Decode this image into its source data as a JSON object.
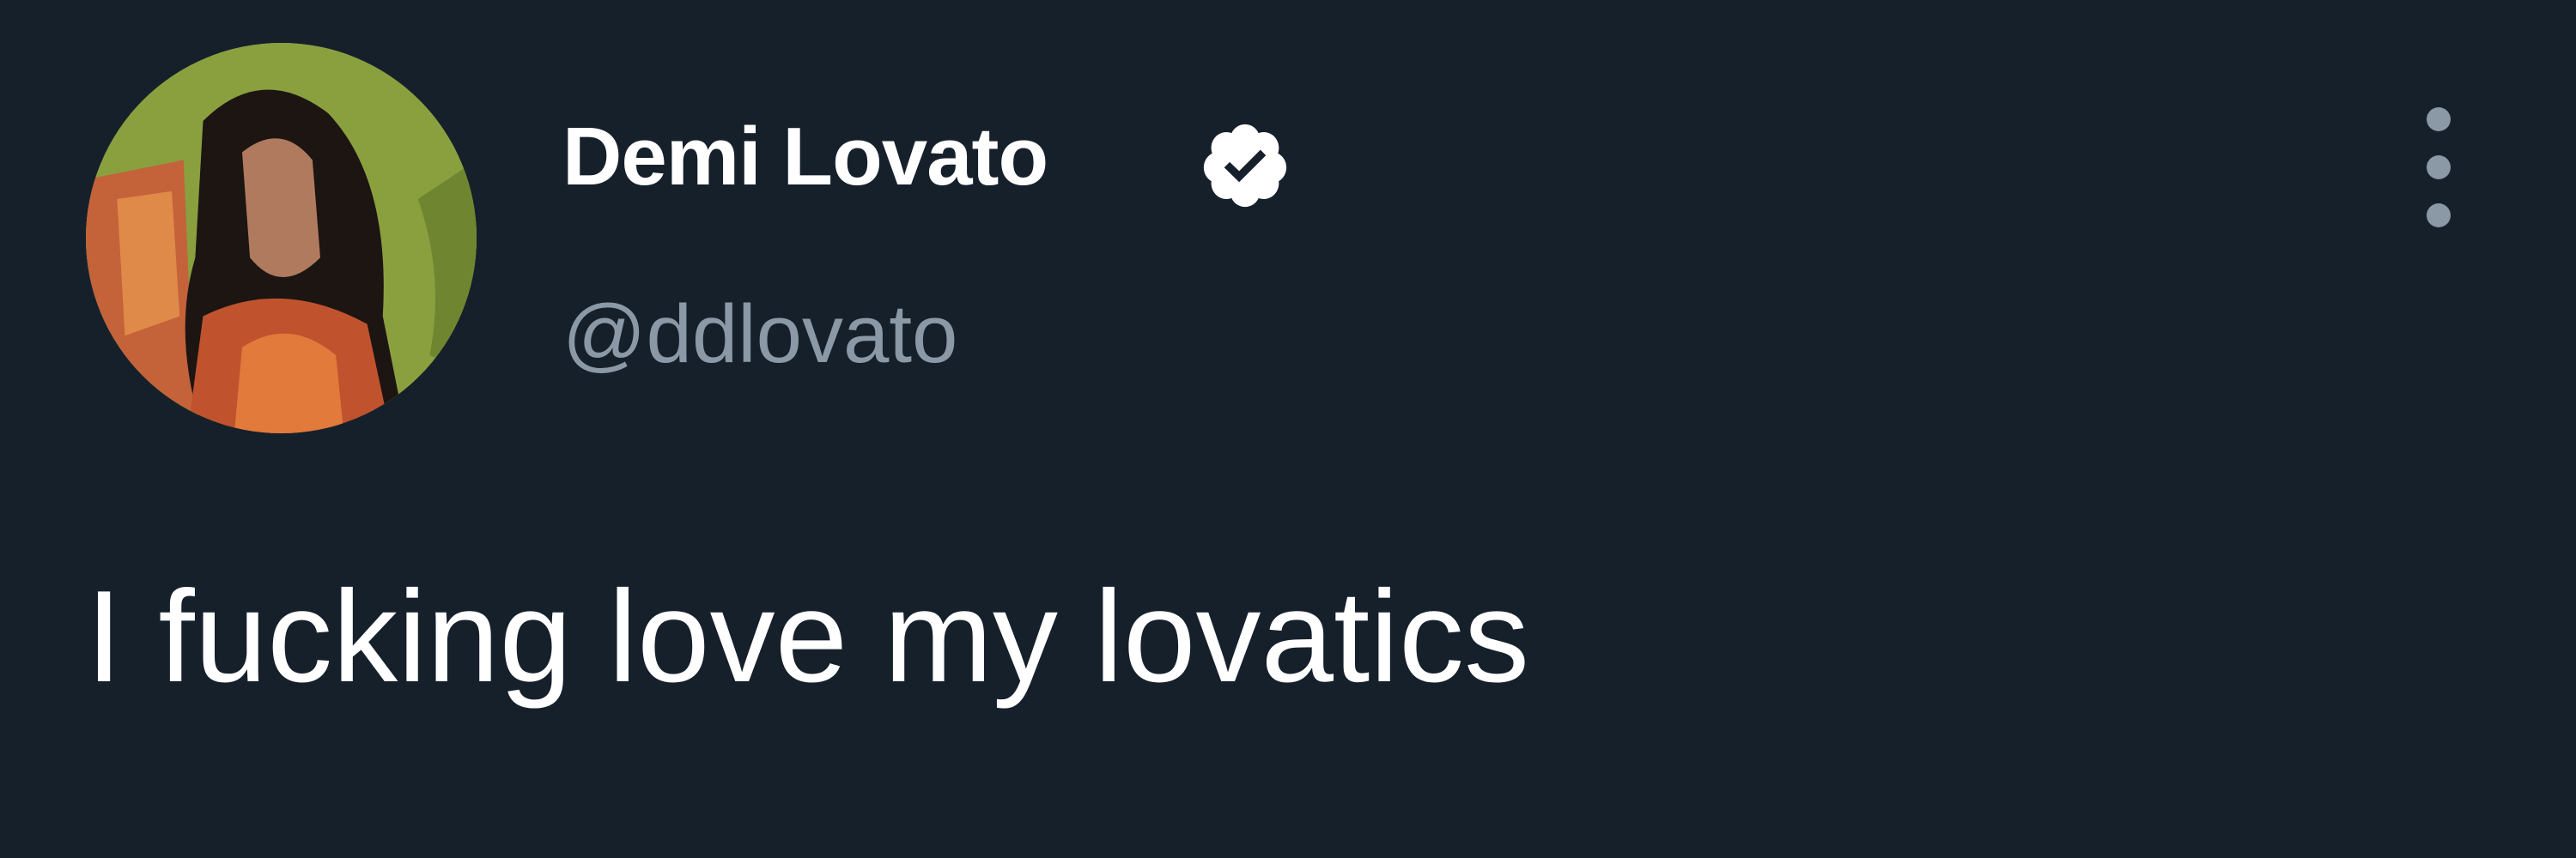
{
  "author": {
    "display_name": "Demi Lovato",
    "handle": "@ddlovato",
    "verified": true,
    "avatar_icon": "profile-photo"
  },
  "tweet": {
    "text": "I fucking love my lovatics"
  },
  "actions": {
    "more_icon": "more-vertical-icon"
  },
  "colors": {
    "background": "#16202b",
    "text_primary": "#ffffff",
    "text_secondary": "#8b98a5",
    "link": "#1d9bf0"
  }
}
